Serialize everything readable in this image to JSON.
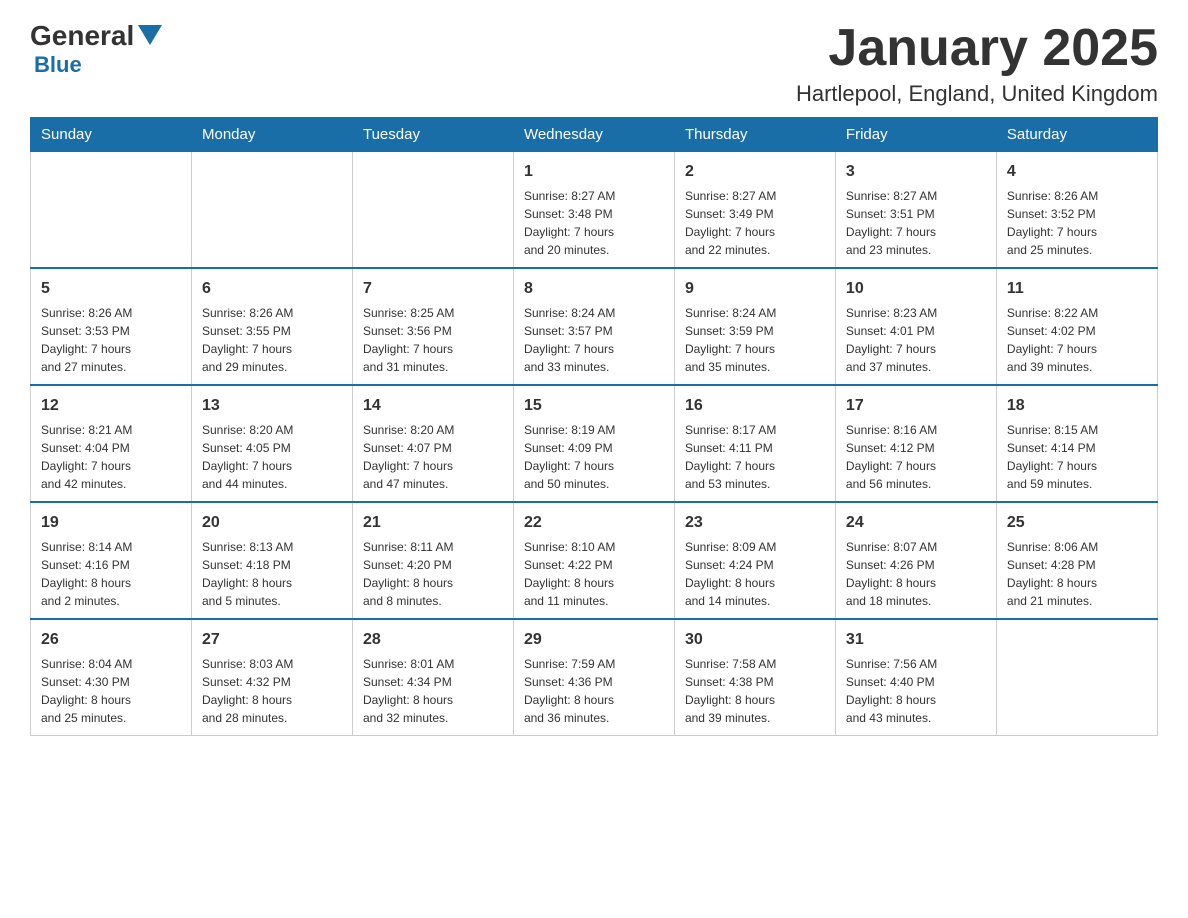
{
  "header": {
    "logo_general": "General",
    "logo_blue": "Blue",
    "month_title": "January 2025",
    "location": "Hartlepool, England, United Kingdom"
  },
  "days_of_week": [
    "Sunday",
    "Monday",
    "Tuesday",
    "Wednesday",
    "Thursday",
    "Friday",
    "Saturday"
  ],
  "weeks": [
    [
      {
        "day": "",
        "info": ""
      },
      {
        "day": "",
        "info": ""
      },
      {
        "day": "",
        "info": ""
      },
      {
        "day": "1",
        "info": "Sunrise: 8:27 AM\nSunset: 3:48 PM\nDaylight: 7 hours\nand 20 minutes."
      },
      {
        "day": "2",
        "info": "Sunrise: 8:27 AM\nSunset: 3:49 PM\nDaylight: 7 hours\nand 22 minutes."
      },
      {
        "day": "3",
        "info": "Sunrise: 8:27 AM\nSunset: 3:51 PM\nDaylight: 7 hours\nand 23 minutes."
      },
      {
        "day": "4",
        "info": "Sunrise: 8:26 AM\nSunset: 3:52 PM\nDaylight: 7 hours\nand 25 minutes."
      }
    ],
    [
      {
        "day": "5",
        "info": "Sunrise: 8:26 AM\nSunset: 3:53 PM\nDaylight: 7 hours\nand 27 minutes."
      },
      {
        "day": "6",
        "info": "Sunrise: 8:26 AM\nSunset: 3:55 PM\nDaylight: 7 hours\nand 29 minutes."
      },
      {
        "day": "7",
        "info": "Sunrise: 8:25 AM\nSunset: 3:56 PM\nDaylight: 7 hours\nand 31 minutes."
      },
      {
        "day": "8",
        "info": "Sunrise: 8:24 AM\nSunset: 3:57 PM\nDaylight: 7 hours\nand 33 minutes."
      },
      {
        "day": "9",
        "info": "Sunrise: 8:24 AM\nSunset: 3:59 PM\nDaylight: 7 hours\nand 35 minutes."
      },
      {
        "day": "10",
        "info": "Sunrise: 8:23 AM\nSunset: 4:01 PM\nDaylight: 7 hours\nand 37 minutes."
      },
      {
        "day": "11",
        "info": "Sunrise: 8:22 AM\nSunset: 4:02 PM\nDaylight: 7 hours\nand 39 minutes."
      }
    ],
    [
      {
        "day": "12",
        "info": "Sunrise: 8:21 AM\nSunset: 4:04 PM\nDaylight: 7 hours\nand 42 minutes."
      },
      {
        "day": "13",
        "info": "Sunrise: 8:20 AM\nSunset: 4:05 PM\nDaylight: 7 hours\nand 44 minutes."
      },
      {
        "day": "14",
        "info": "Sunrise: 8:20 AM\nSunset: 4:07 PM\nDaylight: 7 hours\nand 47 minutes."
      },
      {
        "day": "15",
        "info": "Sunrise: 8:19 AM\nSunset: 4:09 PM\nDaylight: 7 hours\nand 50 minutes."
      },
      {
        "day": "16",
        "info": "Sunrise: 8:17 AM\nSunset: 4:11 PM\nDaylight: 7 hours\nand 53 minutes."
      },
      {
        "day": "17",
        "info": "Sunrise: 8:16 AM\nSunset: 4:12 PM\nDaylight: 7 hours\nand 56 minutes."
      },
      {
        "day": "18",
        "info": "Sunrise: 8:15 AM\nSunset: 4:14 PM\nDaylight: 7 hours\nand 59 minutes."
      }
    ],
    [
      {
        "day": "19",
        "info": "Sunrise: 8:14 AM\nSunset: 4:16 PM\nDaylight: 8 hours\nand 2 minutes."
      },
      {
        "day": "20",
        "info": "Sunrise: 8:13 AM\nSunset: 4:18 PM\nDaylight: 8 hours\nand 5 minutes."
      },
      {
        "day": "21",
        "info": "Sunrise: 8:11 AM\nSunset: 4:20 PM\nDaylight: 8 hours\nand 8 minutes."
      },
      {
        "day": "22",
        "info": "Sunrise: 8:10 AM\nSunset: 4:22 PM\nDaylight: 8 hours\nand 11 minutes."
      },
      {
        "day": "23",
        "info": "Sunrise: 8:09 AM\nSunset: 4:24 PM\nDaylight: 8 hours\nand 14 minutes."
      },
      {
        "day": "24",
        "info": "Sunrise: 8:07 AM\nSunset: 4:26 PM\nDaylight: 8 hours\nand 18 minutes."
      },
      {
        "day": "25",
        "info": "Sunrise: 8:06 AM\nSunset: 4:28 PM\nDaylight: 8 hours\nand 21 minutes."
      }
    ],
    [
      {
        "day": "26",
        "info": "Sunrise: 8:04 AM\nSunset: 4:30 PM\nDaylight: 8 hours\nand 25 minutes."
      },
      {
        "day": "27",
        "info": "Sunrise: 8:03 AM\nSunset: 4:32 PM\nDaylight: 8 hours\nand 28 minutes."
      },
      {
        "day": "28",
        "info": "Sunrise: 8:01 AM\nSunset: 4:34 PM\nDaylight: 8 hours\nand 32 minutes."
      },
      {
        "day": "29",
        "info": "Sunrise: 7:59 AM\nSunset: 4:36 PM\nDaylight: 8 hours\nand 36 minutes."
      },
      {
        "day": "30",
        "info": "Sunrise: 7:58 AM\nSunset: 4:38 PM\nDaylight: 8 hours\nand 39 minutes."
      },
      {
        "day": "31",
        "info": "Sunrise: 7:56 AM\nSunset: 4:40 PM\nDaylight: 8 hours\nand 43 minutes."
      },
      {
        "day": "",
        "info": ""
      }
    ]
  ]
}
